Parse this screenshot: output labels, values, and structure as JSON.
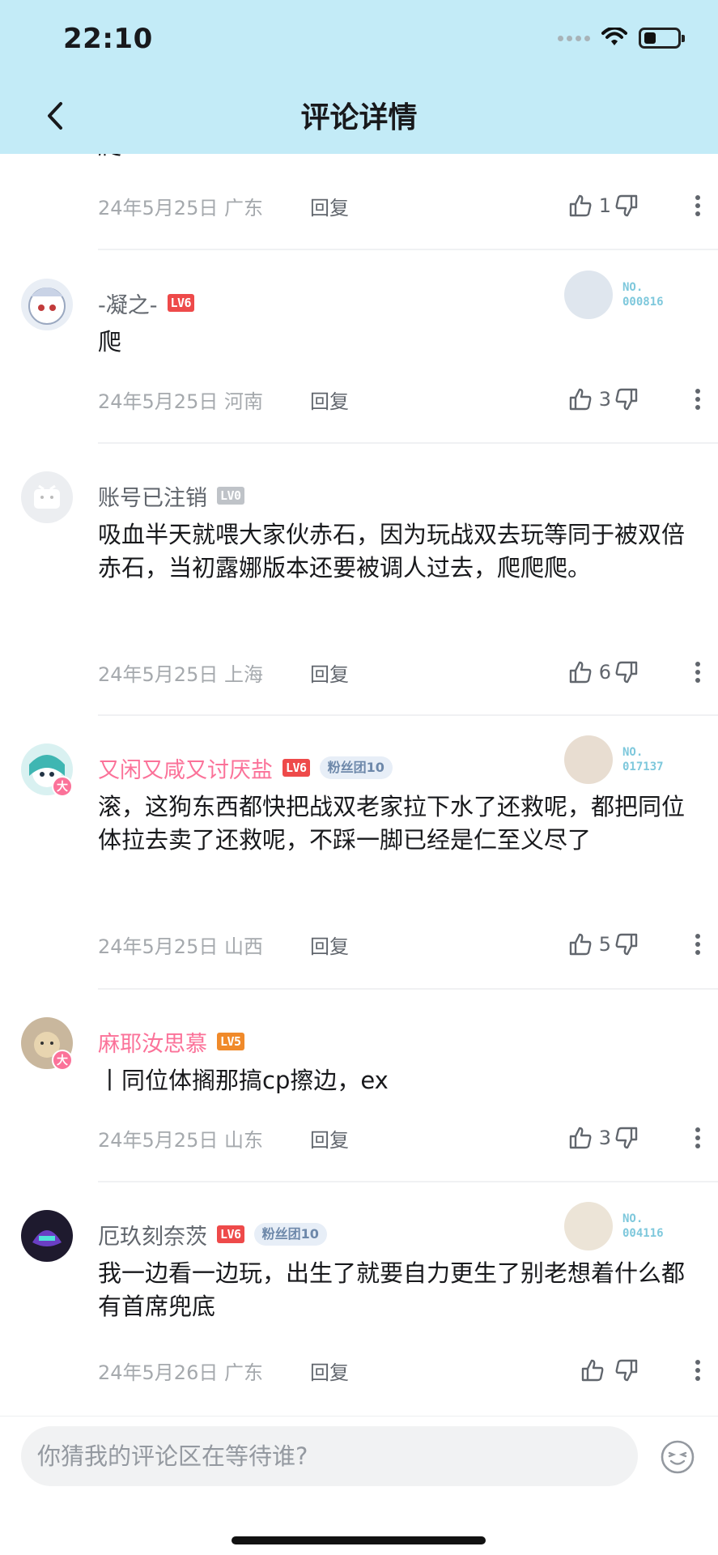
{
  "status_bar": {
    "time": "22:10"
  },
  "nav": {
    "title": "评论详情"
  },
  "comments": [
    {
      "text_fragment": "爬",
      "date": "24年5月25日",
      "location": "广东",
      "reply": "回复",
      "likes": "1"
    },
    {
      "username": "-凝之-",
      "level": "LV6",
      "text": "爬",
      "date": "24年5月25日",
      "location": "河南",
      "reply": "回复",
      "likes": "3",
      "medal_no": "NO.\n000816"
    },
    {
      "username": "账号已注销",
      "level": "LV0",
      "text": "吸血半天就喂大家伙赤石，因为玩战双去玩等同于被双倍赤石，当初露娜版本还要被调人过去，爬爬爬。",
      "date": "24年5月25日",
      "location": "上海",
      "reply": "回复",
      "likes": "6"
    },
    {
      "username": "又闲又咸又讨厌盐",
      "level": "LV6",
      "fan": "粉丝团10",
      "text": "滚，这狗东西都快把战双老家拉下水了还救呢，都把同位体拉去卖了还救呢，不踩一脚已经是仁至义尽了",
      "date": "24年5月25日",
      "location": "山西",
      "reply": "回复",
      "likes": "5",
      "medal_no": "NO.\n017137",
      "badge": "大"
    },
    {
      "username": "麻耶汝思慕",
      "level": "LV5",
      "text": "丨同位体搁那搞cp擦边，ex",
      "date": "24年5月25日",
      "location": "山东",
      "reply": "回复",
      "likes": "3",
      "badge": "大"
    },
    {
      "username": "厄玖刻奈茨",
      "level": "LV6",
      "fan": "粉丝团10",
      "text": "我一边看一边玩，出生了就要自力更生了别老想着什么都有首席兜底",
      "date": "24年5月26日",
      "location": "广东",
      "reply": "回复",
      "likes": "",
      "medal_no": "NO.\n004116"
    }
  ],
  "composer": {
    "placeholder": "你猜我的评论区在等待谁?"
  },
  "colors": {
    "header_bg": "#c3ebf7",
    "pink": "#fb7299",
    "lv6": "#ee4a4a",
    "lv5": "#f08a2a",
    "lv0": "#bfc3c8"
  }
}
